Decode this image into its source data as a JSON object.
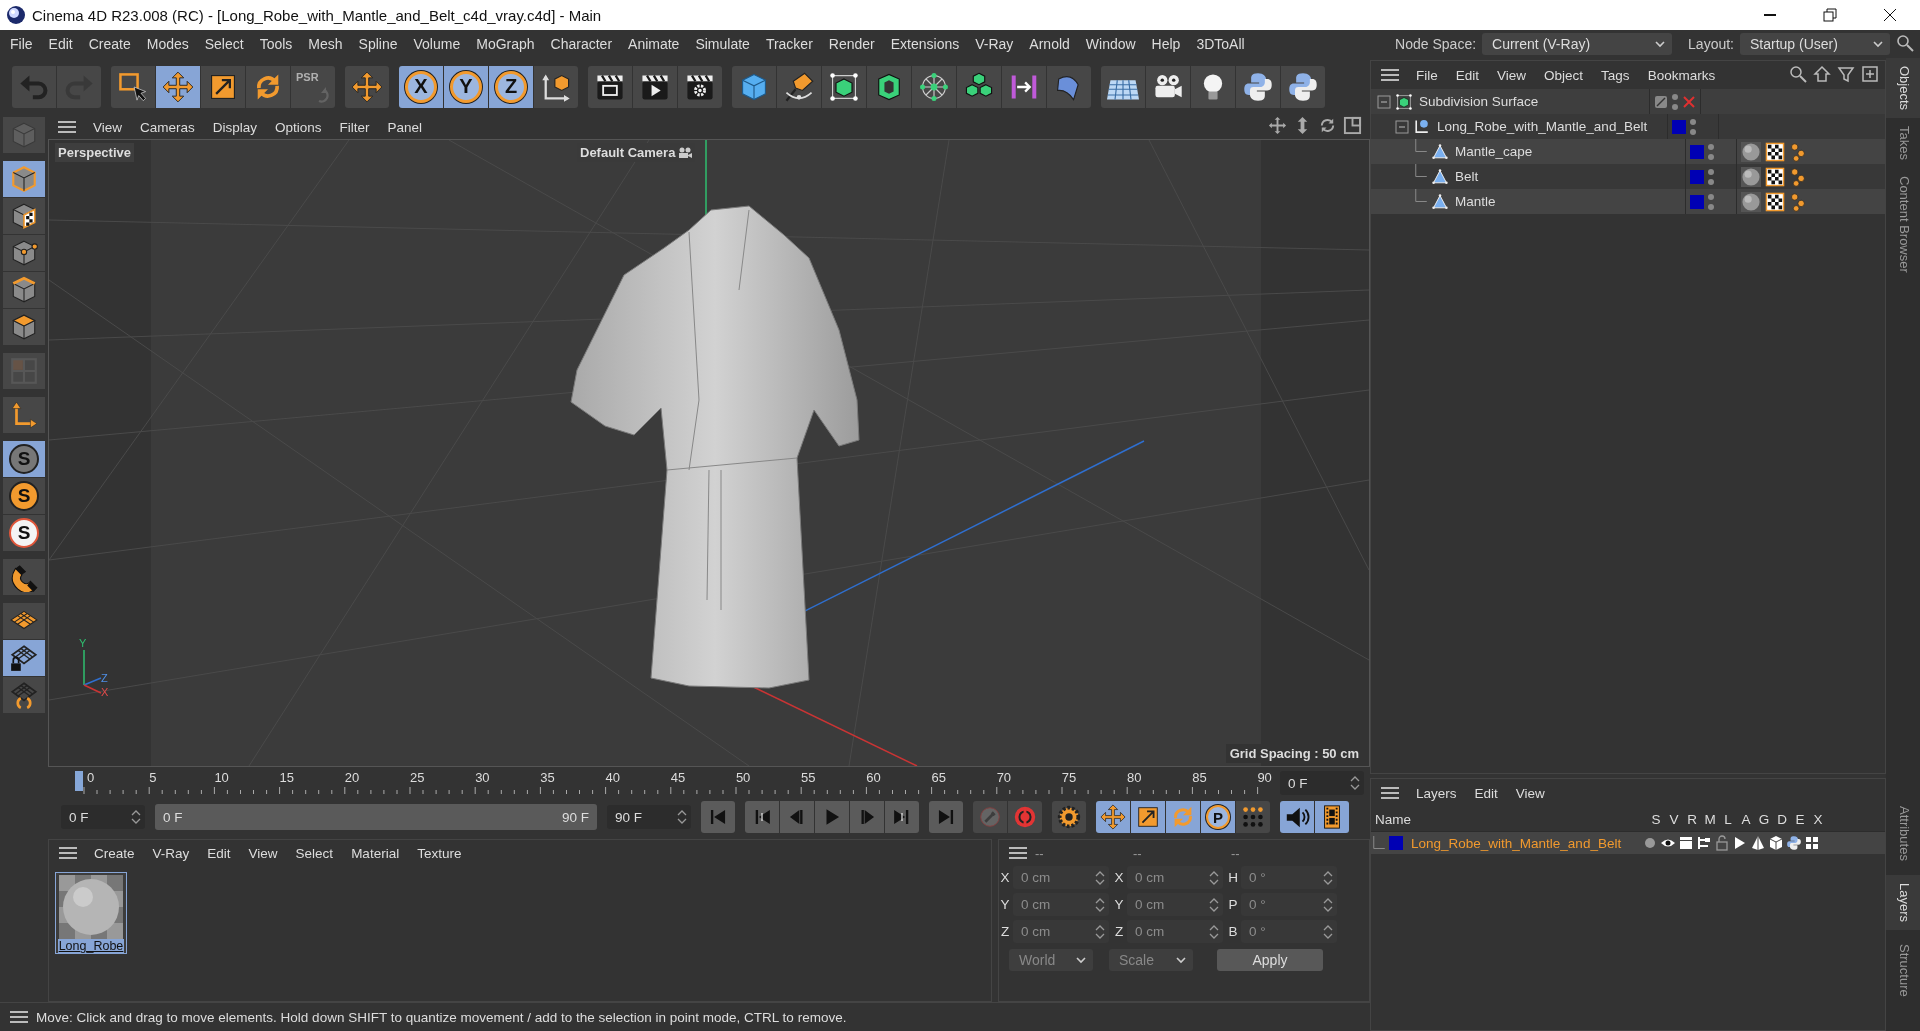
{
  "window": {
    "title": "Cinema 4D R23.008 (RC) - [Long_Robe_with_Mantle_and_Belt_c4d_vray.c4d] - Main"
  },
  "menu": [
    "File",
    "Edit",
    "Create",
    "Modes",
    "Select",
    "Tools",
    "Mesh",
    "Spline",
    "Volume",
    "MoGraph",
    "Character",
    "Animate",
    "Simulate",
    "Tracker",
    "Render",
    "Extensions",
    "V-Ray",
    "Arnold",
    "Window",
    "Help",
    "3DToAll"
  ],
  "node_space": {
    "label": "Node Space:",
    "value": "Current (V-Ray)"
  },
  "layout": {
    "label": "Layout:",
    "value": "Startup (User)"
  },
  "toolbar": [
    [
      {
        "kind": "undo",
        "selected": false,
        "disabled": false
      },
      {
        "kind": "redo",
        "selected": false,
        "disabled": true
      }
    ],
    [
      {
        "kind": "select",
        "selected": false,
        "disabled": false
      },
      {
        "kind": "move",
        "selected": true,
        "disabled": false
      },
      {
        "kind": "scale",
        "selected": false,
        "disabled": false
      },
      {
        "kind": "rotate",
        "selected": false,
        "disabled": false
      },
      {
        "kind": "psr",
        "label": "PSR",
        "selected": false,
        "disabled": true
      }
    ],
    [
      {
        "kind": "move",
        "selected": false,
        "disabled": false
      }
    ],
    [
      {
        "kind": "axis",
        "label": "X",
        "selected": true,
        "disabled": false
      },
      {
        "kind": "axis",
        "label": "Y",
        "selected": true,
        "disabled": false
      },
      {
        "kind": "axis",
        "label": "Z",
        "selected": true,
        "disabled": false
      },
      {
        "kind": "coordinate-system",
        "selected": false,
        "disabled": false
      }
    ],
    [
      {
        "kind": "render-view",
        "selected": false,
        "disabled": false
      },
      {
        "kind": "render",
        "selected": false,
        "disabled": false
      },
      {
        "kind": "render-settings",
        "selected": false,
        "disabled": false
      }
    ],
    [
      {
        "kind": "cube",
        "selected": false,
        "disabled": false
      },
      {
        "kind": "pen",
        "selected": false,
        "disabled": false
      },
      {
        "kind": "subdivision",
        "selected": false,
        "disabled": false
      },
      {
        "kind": "extrude",
        "selected": false,
        "disabled": false
      },
      {
        "kind": "cloner",
        "selected": false,
        "disabled": false
      },
      {
        "kind": "cubes",
        "selected": false,
        "disabled": false
      },
      {
        "kind": "measure",
        "selected": false,
        "disabled": false
      },
      {
        "kind": "deformer",
        "selected": false,
        "disabled": false
      }
    ],
    [
      {
        "kind": "floor",
        "selected": false,
        "disabled": false
      },
      {
        "kind": "camera",
        "selected": false,
        "disabled": false
      },
      {
        "kind": "light",
        "selected": false,
        "disabled": false
      },
      {
        "kind": "python",
        "selected": false,
        "disabled": false
      },
      {
        "kind": "python",
        "selected": false,
        "disabled": false
      }
    ]
  ],
  "left_toolbar": [
    [
      {
        "kind": "make-editable",
        "selected": false,
        "disabled": true
      }
    ],
    [
      {
        "kind": "model",
        "selected": true,
        "disabled": false
      },
      {
        "kind": "texture",
        "selected": false,
        "disabled": false
      },
      {
        "kind": "points",
        "selected": false,
        "disabled": false
      },
      {
        "kind": "edges",
        "selected": false,
        "disabled": false
      },
      {
        "kind": "polygons",
        "selected": false,
        "disabled": false
      }
    ],
    [
      {
        "kind": "uv",
        "selected": false,
        "disabled": true
      }
    ],
    [
      {
        "kind": "axis-mode",
        "selected": false,
        "disabled": false
      }
    ],
    [
      {
        "kind": "solo",
        "label": "S",
        "selected": true,
        "disabled": false
      },
      {
        "kind": "solo-single",
        "label": "S",
        "selected": false,
        "disabled": false
      },
      {
        "kind": "solo-hierarchy",
        "label": "S",
        "selected": false,
        "disabled": false
      }
    ],
    [
      {
        "kind": "magnet",
        "selected": false,
        "disabled": false
      }
    ],
    [
      {
        "kind": "workplane",
        "selected": false,
        "disabled": false
      },
      {
        "kind": "grid-lock",
        "selected": true,
        "disabled": false
      },
      {
        "kind": "grid-rotate",
        "selected": false,
        "disabled": false
      }
    ]
  ],
  "viewport": {
    "menu": [
      "View",
      "Cameras",
      "Display",
      "Options",
      "Filter",
      "Panel"
    ],
    "name": "Perspective",
    "camera": "Default Camera",
    "grid_spacing": "Grid Spacing : 50 cm",
    "axes": [
      "Y",
      "Z",
      "X"
    ]
  },
  "timeline": {
    "labels": [
      "0",
      "5",
      "10",
      "15",
      "20",
      "25",
      "30",
      "35",
      "40",
      "45",
      "50",
      "55",
      "60",
      "65",
      "70",
      "75",
      "80",
      "85",
      "90"
    ],
    "playhead": {
      "level": 0
    },
    "current_frame": "0 F",
    "start": "0 F",
    "range_start": "0 F",
    "range_end": "90 F",
    "end": "90 F",
    "range": {
      "level": 1
    },
    "transport": [
      [
        {
          "kind": "go-start"
        }
      ],
      [
        {
          "kind": "prev-key"
        },
        {
          "kind": "prev-frame"
        },
        {
          "kind": "play"
        },
        {
          "kind": "next-frame"
        },
        {
          "kind": "next-key"
        }
      ],
      [
        {
          "kind": "go-end"
        }
      ]
    ],
    "keys": [
      [
        {
          "kind": "record",
          "selected": false,
          "disabled": true
        },
        {
          "kind": "autokey",
          "selected": false,
          "disabled": false
        }
      ],
      [
        {
          "kind": "key-settings",
          "selected": false,
          "disabled": false
        }
      ],
      [
        {
          "kind": "move",
          "selected": true,
          "disabled": false
        },
        {
          "kind": "scale",
          "selected": true,
          "disabled": false
        },
        {
          "kind": "rotate",
          "selected": true,
          "disabled": false
        },
        {
          "kind": "param",
          "label": "P",
          "selected": true,
          "disabled": false
        },
        {
          "kind": "point-level",
          "selected": false,
          "disabled": false
        }
      ],
      [
        {
          "kind": "sound",
          "selected": true,
          "disabled": false
        },
        {
          "kind": "film",
          "selected": true,
          "disabled": false
        }
      ]
    ]
  },
  "materials": {
    "menu": [
      "Create",
      "V-Ray",
      "Edit",
      "View",
      "Select",
      "Material",
      "Texture"
    ],
    "items": [
      {
        "name": "Long_Robe",
        "selected": true
      }
    ]
  },
  "coordinates": {
    "columns": [
      {
        "header": "--",
        "fields": [
          {
            "label": "X",
            "value": "0 cm"
          },
          {
            "label": "Y",
            "value": "0 cm"
          },
          {
            "label": "Z",
            "value": "0 cm"
          }
        ]
      },
      {
        "header": "--",
        "fields": [
          {
            "label": "X",
            "value": "0 cm"
          },
          {
            "label": "Y",
            "value": "0 cm"
          },
          {
            "label": "Z",
            "value": "0 cm"
          }
        ]
      },
      {
        "header": "--",
        "fields": [
          {
            "label": "H",
            "value": "0 °"
          },
          {
            "label": "P",
            "value": "0 °"
          },
          {
            "label": "B",
            "value": "0 °"
          }
        ]
      }
    ],
    "mode": "World",
    "size_mode": "Scale",
    "apply": "Apply"
  },
  "status_bar": "Move: Click and drag to move elements. Hold down SHIFT to quantize movement / add to the selection in point mode, CTRL to remove.",
  "objects": {
    "menu": [
      "File",
      "Edit",
      "View",
      "Object",
      "Tags",
      "Bookmarks"
    ],
    "tree": [
      {
        "name": "Subdivision Surface",
        "kind": "subdivision",
        "expanded": true,
        "enabled": false,
        "children": [
          {
            "name": "Long_Robe_with_Mantle_and_Belt",
            "kind": "null",
            "expanded": true,
            "color": "#0000b4",
            "children": [
              {
                "name": "Mantle_cape",
                "kind": "polygon",
                "color": "#0000b4",
                "tags": [
                  {
                    "kind": "material"
                  },
                  {
                    "kind": "uvw"
                  },
                  {
                    "kind": "selection"
                  }
                ]
              },
              {
                "name": "Belt",
                "kind": "polygon",
                "color": "#0000b4",
                "tags": [
                  {
                    "kind": "material"
                  },
                  {
                    "kind": "uvw"
                  },
                  {
                    "kind": "selection"
                  }
                ]
              },
              {
                "name": "Mantle",
                "kind": "polygon",
                "color": "#0000b4",
                "tags": [
                  {
                    "kind": "material"
                  },
                  {
                    "kind": "uvw"
                  },
                  {
                    "kind": "selection"
                  }
                ]
              }
            ]
          }
        ]
      }
    ]
  },
  "layers": {
    "menu": [
      "Layers",
      "Edit",
      "View"
    ],
    "columns": [
      "Name",
      "S",
      "V",
      "R",
      "M",
      "L",
      "A",
      "G",
      "D",
      "E",
      "X"
    ],
    "rows": [
      {
        "name": "Long_Robe_with_Mantle_and_Belt",
        "color": "#0000b4"
      }
    ]
  },
  "side_tabs": {
    "top": [
      {
        "label": "Objects",
        "selected": true
      },
      {
        "label": "Takes",
        "selected": false
      },
      {
        "label": "Content Browser",
        "selected": false
      }
    ],
    "bottom": [
      {
        "label": "Attributes",
        "selected": false
      },
      {
        "label": "Layers",
        "selected": true
      },
      {
        "label": "Structure",
        "selected": false
      }
    ]
  }
}
